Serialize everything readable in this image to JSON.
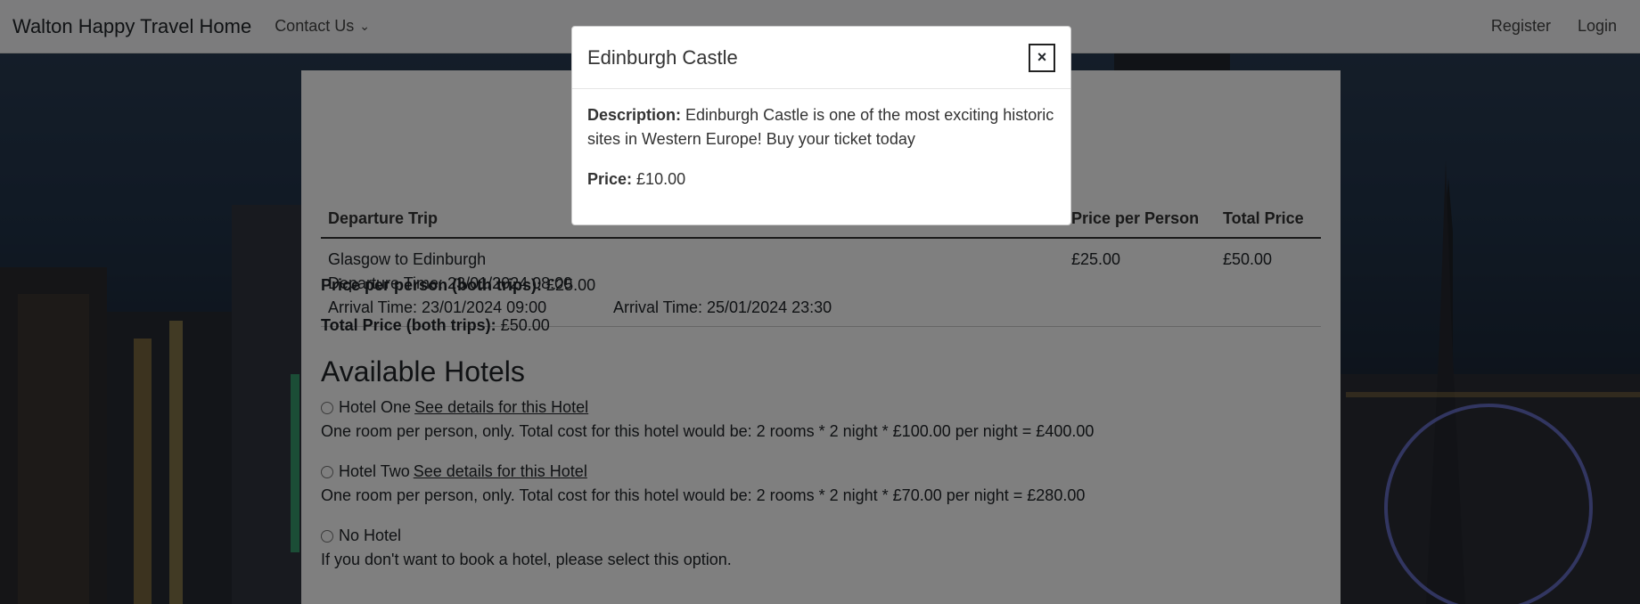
{
  "navbar": {
    "brand": "Walton Happy Travel Home",
    "contact": "Contact Us",
    "contact_caret": "⌄",
    "register": "Register",
    "login": "Login"
  },
  "table": {
    "headers": [
      "Departure Trip",
      "Price per Person",
      "Total Price"
    ],
    "departure": {
      "route": "Glasgow to Edinburgh",
      "departure_time": "Departure Time: 23/01/2024 08:00",
      "arrival_time": "Arrival Time: 23/01/2024 09:00"
    },
    "return_arrival_time": "Arrival Time: 25/01/2024 23:30",
    "price_per_person": "£25.00",
    "total_price": "£50.00"
  },
  "summary": {
    "price_per_person_label": "Price per person (both trips):",
    "price_per_person_value": "£25.00",
    "total_label": "Total Price (both trips):",
    "total_value": "£50.00"
  },
  "hotels": {
    "heading": "Available Hotels",
    "options": [
      {
        "name": "Hotel One",
        "link": "See details for this Hotel",
        "description": "One room per person, only. Total cost for this hotel would be: 2 rooms * 2 night * £100.00 per night = £400.00"
      },
      {
        "name": "Hotel Two",
        "link": "See details for this Hotel",
        "description": "One room per person, only. Total cost for this hotel would be: 2 rooms * 2 night * £70.00 per night = £280.00"
      }
    ],
    "no_hotel": {
      "name": "No Hotel",
      "description": "If you don't want to book a hotel, please select this option."
    }
  },
  "modal": {
    "title": "Edinburgh Castle",
    "close": "×",
    "description_label": "Description:",
    "description": "Edinburgh Castle is one of the most exciting historic sites in Western Europe! Buy your ticket today",
    "price_label": "Price:",
    "price": "£10.00"
  }
}
